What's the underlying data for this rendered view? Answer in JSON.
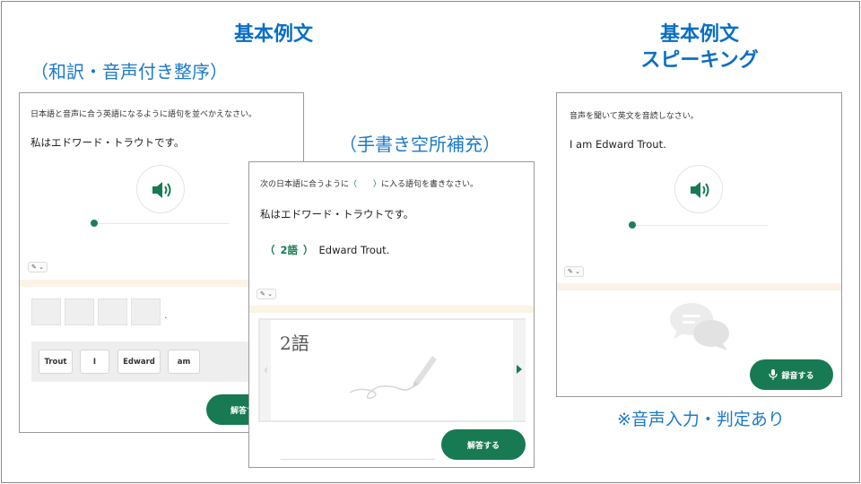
{
  "titles": {
    "left": "基本例文",
    "left_sub": "（和訳・音声付き整序）",
    "middle_sub": "（手書き空所補充）",
    "right_line1": "基本例文",
    "right_line2": "スピーキング",
    "note": "※音声入力・判定あり"
  },
  "card_ordering": {
    "instruction": "日本語と音声に合う英語になるように語句を並べかえなさい。",
    "prompt": "私はエドワード・トラウトです。",
    "tool_label": "✎ ⌄",
    "period": ".",
    "chips": [
      "Trout",
      "I",
      "Edward",
      "am"
    ],
    "answer_button": "解答す"
  },
  "card_fill": {
    "instruction_pre": "次の日本語に合うように",
    "instruction_paren": "（　　）",
    "instruction_post": "に入る語句を書きなさい。",
    "prompt": "私はエドワード・トラウトです。",
    "blank_open": "（",
    "blank_hint": "2語",
    "blank_close": "）",
    "blank_rest": "Edward Trout.",
    "tool_label": "✎ ⌄",
    "handwriting": "2語",
    "answer_button": "解答する"
  },
  "card_speaking": {
    "instruction": "音声を聞いて英文を音読しなさい。",
    "prompt": "I am Edward Trout.",
    "tool_label": "✎ ⌄",
    "record_button": "録音する"
  },
  "colors": {
    "title_blue": "#0a6fc4",
    "green": "#187a52",
    "border": "#9a9a9a"
  }
}
